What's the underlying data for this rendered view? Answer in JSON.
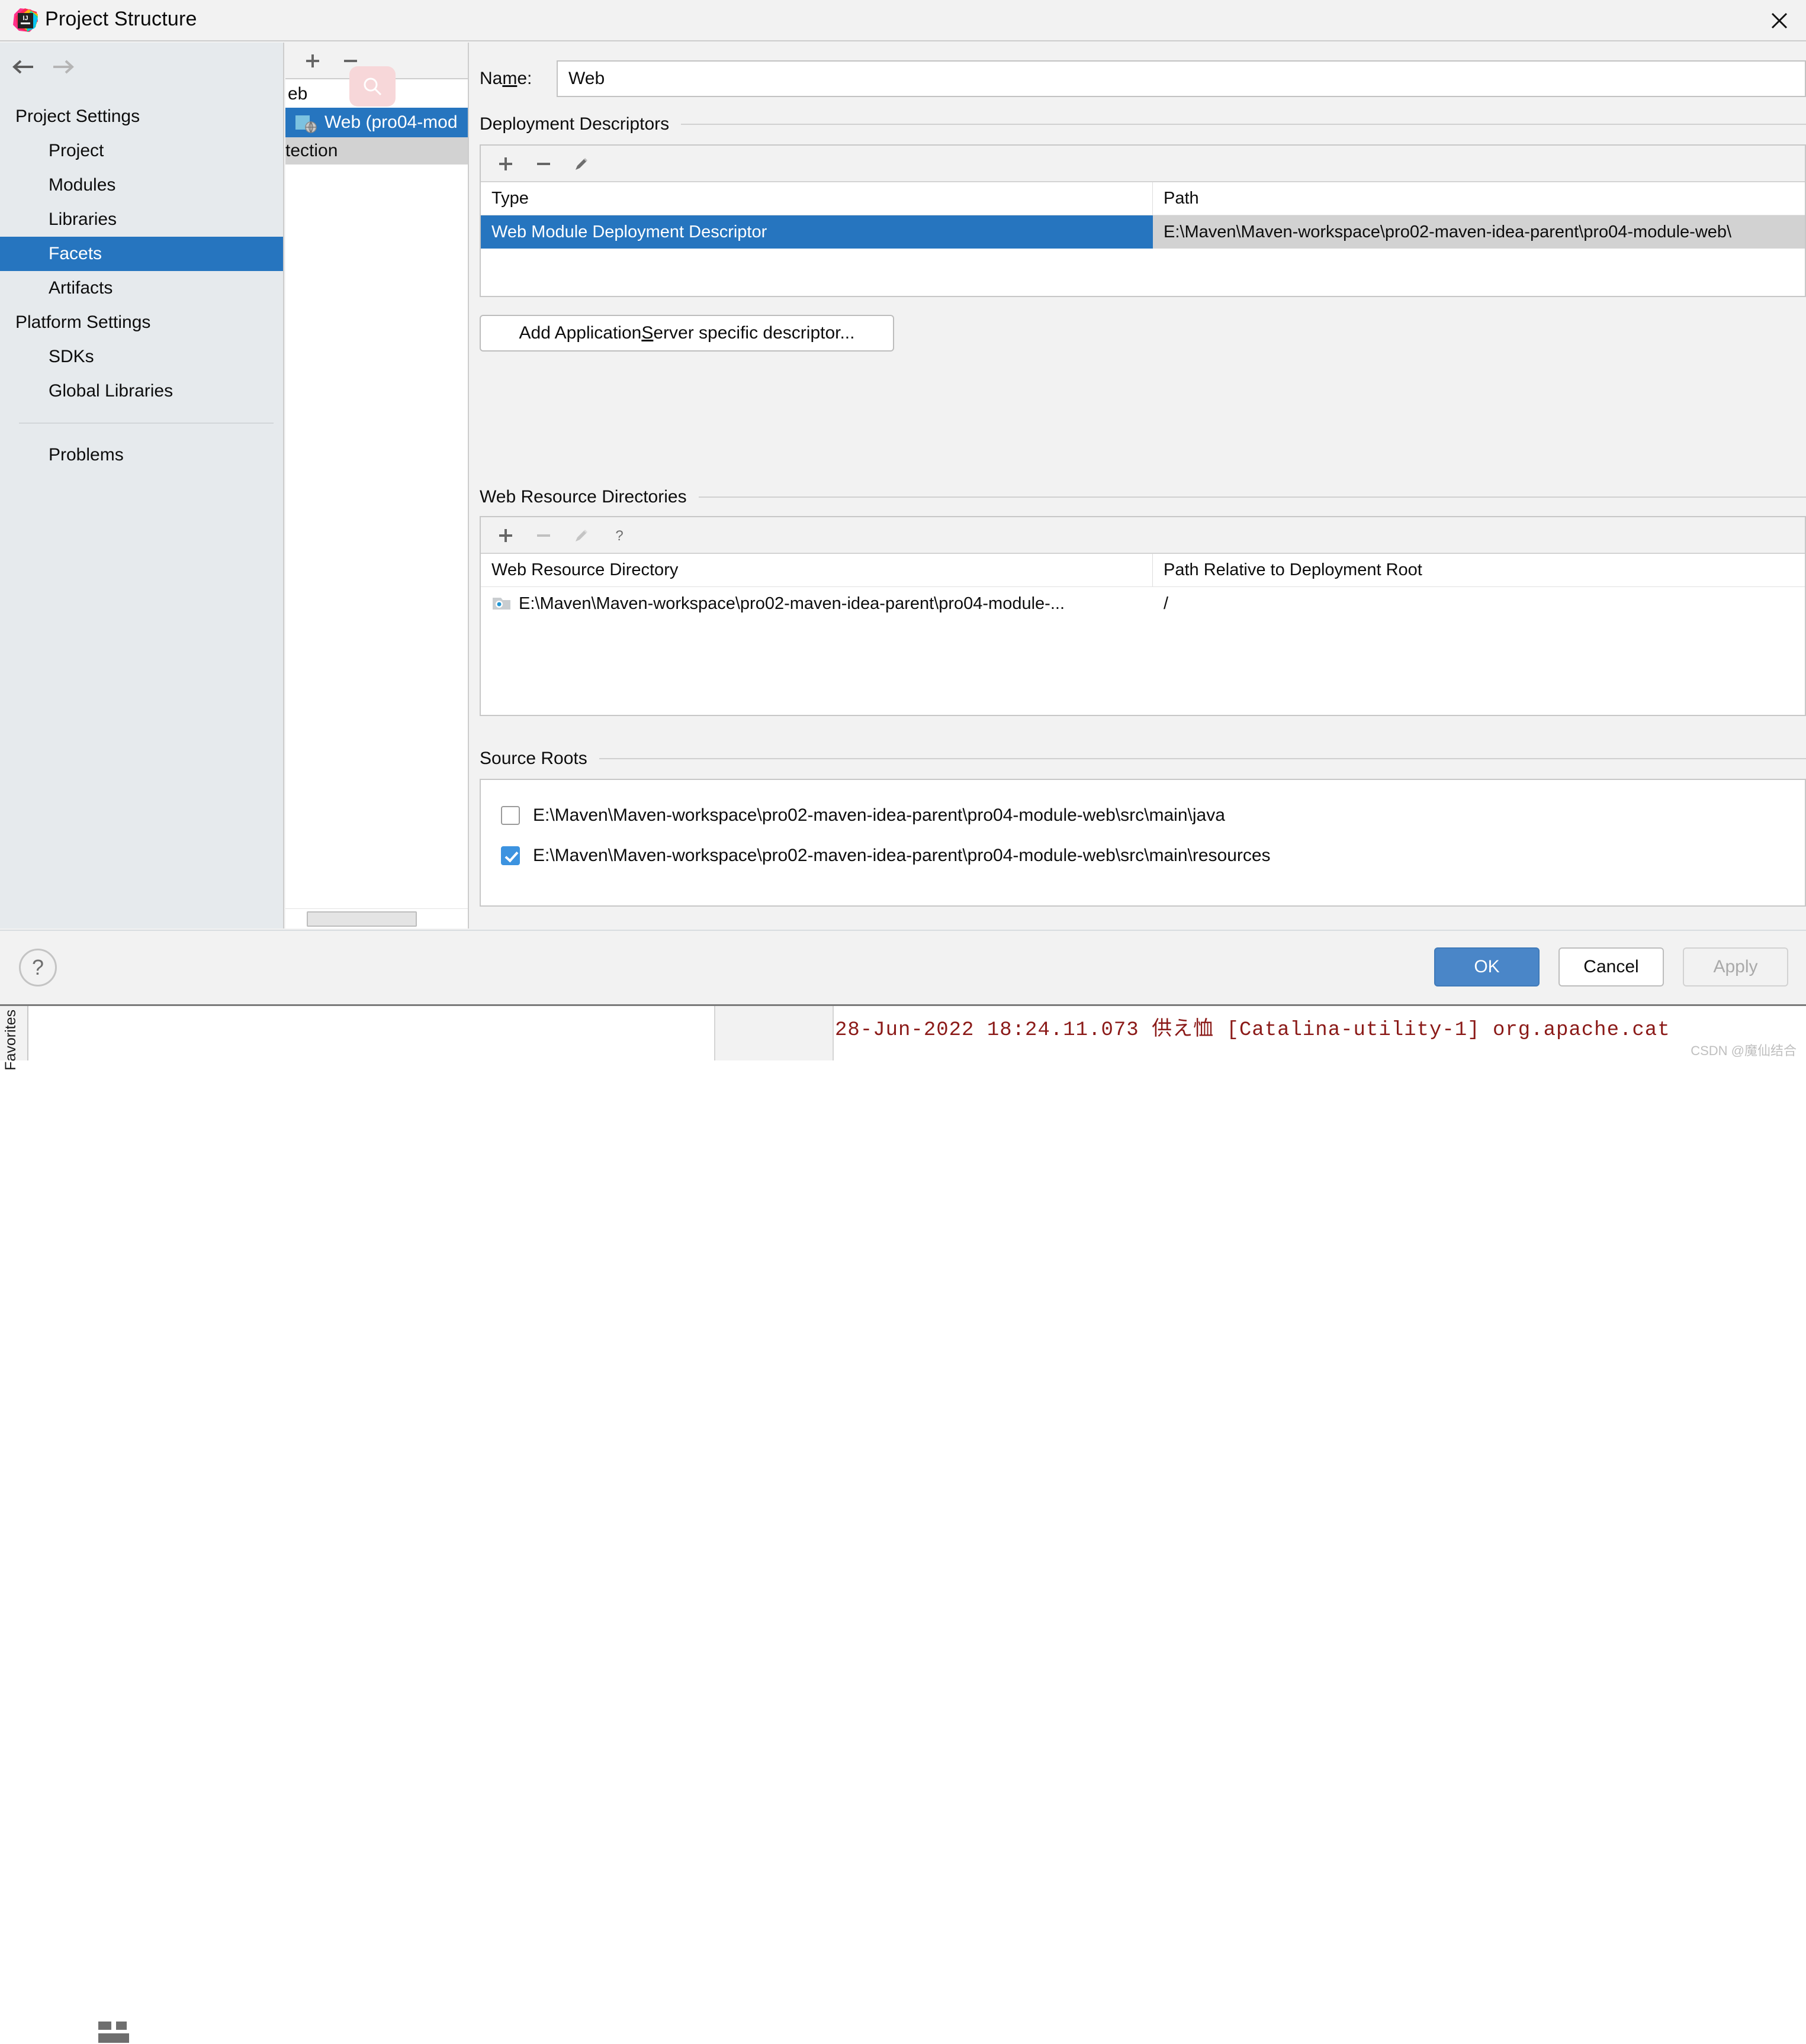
{
  "window": {
    "title": "Project Structure",
    "logo_icon": "intellij-idea-logo-icon",
    "close_icon": "close-icon"
  },
  "sidebar": {
    "back_icon": "arrow-left-icon",
    "forward_icon": "arrow-right-icon",
    "groups": [
      {
        "label": "Project Settings",
        "items": [
          {
            "label": "Project",
            "selected": false
          },
          {
            "label": "Modules",
            "selected": false
          },
          {
            "label": "Libraries",
            "selected": false
          },
          {
            "label": "Facets",
            "selected": true
          },
          {
            "label": "Artifacts",
            "selected": false
          }
        ]
      },
      {
        "label": "Platform Settings",
        "items": [
          {
            "label": "SDKs",
            "selected": false
          },
          {
            "label": "Global Libraries",
            "selected": false
          }
        ]
      }
    ],
    "problems_label": "Problems"
  },
  "facet_tree": {
    "toolbar": {
      "add_icon": "plus-icon",
      "remove_icon": "minus-icon",
      "search_ghost_icon": "search-icon"
    },
    "rows": [
      {
        "label": "eb",
        "state": "clipped",
        "icon": ""
      },
      {
        "label": "Web (pro04-mod",
        "state": "selected",
        "icon": "web-module-icon"
      },
      {
        "label": "tection",
        "state": "muted",
        "icon": ""
      }
    ],
    "scrollbar": "horizontal-scrollbar"
  },
  "main": {
    "name_label_pre": "Na",
    "name_label_mnemonic": "m",
    "name_label_post": "e:",
    "name_value": "Web",
    "deployment_descriptors": {
      "title": "Deployment Descriptors",
      "toolbar": {
        "add_icon": "plus-icon",
        "remove_icon": "minus-icon",
        "edit_icon": "pencil-icon"
      },
      "columns": [
        "Type",
        "Path"
      ],
      "rows": [
        {
          "type": "Web Module Deployment Descriptor",
          "path": "E:\\Maven\\Maven-workspace\\pro02-maven-idea-parent\\pro04-module-web\\",
          "selected": true
        }
      ]
    },
    "add_descriptor_button": {
      "pre": "Add Application ",
      "mnemonic": "S",
      "post": "erver specific descriptor..."
    },
    "web_resource_directories": {
      "title": "Web Resource Directories",
      "toolbar": {
        "add_icon": "plus-icon",
        "remove_icon": "minus-icon",
        "edit_icon": "pencil-icon",
        "help_icon": "question-icon"
      },
      "columns": [
        "Web Resource Directory",
        "Path Relative to Deployment Root"
      ],
      "rows": [
        {
          "directory": "E:\\Maven\\Maven-workspace\\pro02-maven-idea-parent\\pro04-module-...",
          "relative": "/",
          "icon": "folder-icon"
        }
      ]
    },
    "source_roots": {
      "title": "Source Roots",
      "rows": [
        {
          "path": "E:\\Maven\\Maven-workspace\\pro02-maven-idea-parent\\pro04-module-web\\src\\main\\java",
          "checked": false
        },
        {
          "path": "E:\\Maven\\Maven-workspace\\pro02-maven-idea-parent\\pro04-module-web\\src\\main\\resources",
          "checked": true
        }
      ]
    }
  },
  "footer": {
    "help_icon": "question-icon",
    "ok_label": "OK",
    "cancel_label": "Cancel",
    "apply_label": "Apply",
    "apply_enabled": false
  },
  "background": {
    "favorites_tab": "Favorites",
    "console_line": "28-Jun-2022 18:24.11.073 供え恤 [Catalina-utility-1] org.apache.cat",
    "watermark": "CSDN @魔仙结合"
  },
  "colors": {
    "accent_selection": "#2675bf",
    "primary_button": "#4a86c8",
    "nav_background": "#e6eaed",
    "dialog_background": "#f2f2f2",
    "console_text": "#8b1a18"
  }
}
